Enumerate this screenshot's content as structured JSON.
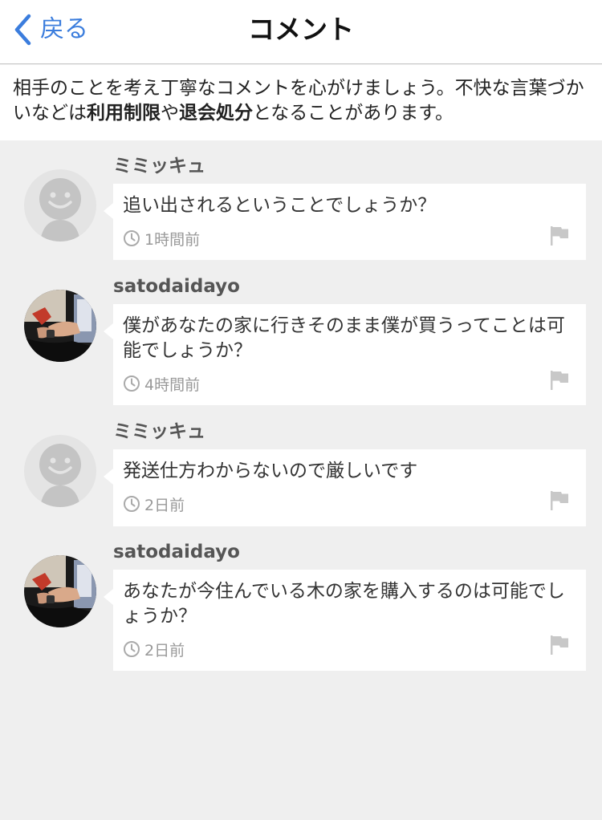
{
  "navbar": {
    "back_label": "戻る",
    "title": "コメント"
  },
  "notice": {
    "text_before": "相手のことを考え丁寧なコメントを心がけましょう。不快な言葉づかいなどは",
    "bold_1": "利用制限",
    "text_middle": "や",
    "bold_2": "退会処分",
    "text_after": "となることがあります。"
  },
  "comments": [
    {
      "username": "ミミッキュ",
      "text": "追い出されるということでしょうか？",
      "time": "1時間前",
      "avatar": "default-avatar"
    },
    {
      "username": "satodaidayo",
      "text": "僕があなたの家に行きそのまま僕が買うってことは可能でしょうか？",
      "time": "4時間前",
      "avatar": "photo-avatar"
    },
    {
      "username": "ミミッキュ",
      "text": "発送仕方わからないので厳しいです",
      "time": "2日前",
      "avatar": "default-avatar"
    },
    {
      "username": "satodaidayo",
      "text": "あなたが今住んでいる木の家を購入するのは可能でしょうか？",
      "time": "2日前",
      "avatar": "photo-avatar"
    }
  ],
  "colors": {
    "accent": "#3b7ddd",
    "background": "#efefef",
    "bubble": "#ffffff",
    "meta_text": "#999999"
  },
  "icons": [
    "chevron-left-icon",
    "clock-icon",
    "flag-icon",
    "default-avatar-face-icon"
  ]
}
